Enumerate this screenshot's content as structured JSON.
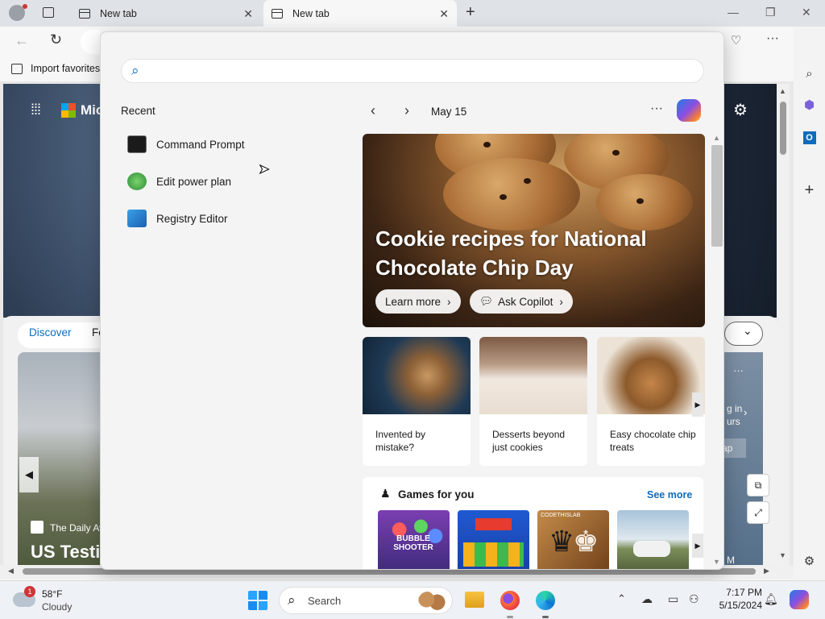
{
  "browser": {
    "tabs": [
      {
        "label": "New tab"
      },
      {
        "label": "New tab"
      }
    ],
    "favorites_bar": {
      "import_label": "Import favorites"
    }
  },
  "background_page": {
    "brand_text": "Mic",
    "feed_tab_active": "Discover",
    "feed_tab_next": "Fo",
    "news_source": "The Daily Av",
    "news_headline": "US Testi",
    "side_text": [
      "g in",
      "urs",
      "ap",
      "M"
    ]
  },
  "search_panel": {
    "recent_heading": "Recent",
    "recent_items": [
      {
        "label": "Command Prompt",
        "icon": "command-prompt-icon"
      },
      {
        "label": "Edit power plan",
        "icon": "power-plan-icon"
      },
      {
        "label": "Registry Editor",
        "icon": "registry-editor-icon"
      }
    ],
    "date_label": "May 15",
    "feature": {
      "title": "Cookie recipes for National Chocolate Chip Day",
      "learn_more": "Learn more",
      "ask_copilot": "Ask Copilot"
    },
    "cards": [
      {
        "caption": "Invented by mistake?"
      },
      {
        "caption": "Desserts beyond just cookies"
      },
      {
        "caption": "Easy chocolate chip treats"
      }
    ],
    "games": {
      "heading": "Games for you",
      "see_more": "See more",
      "items": [
        {
          "label": "BUBBLE SHOOTER"
        },
        {
          "label": ""
        },
        {
          "label": "CODETHISLAB"
        },
        {
          "label": ""
        }
      ]
    }
  },
  "taskbar": {
    "weather": {
      "temp": "58°F",
      "condition": "Cloudy",
      "badge": "1"
    },
    "search_placeholder": "Search",
    "time": "7:17 PM",
    "date": "5/15/2024"
  },
  "colors": {
    "accent": "#0f6cbd",
    "titlebar": "#dfe3e8"
  }
}
